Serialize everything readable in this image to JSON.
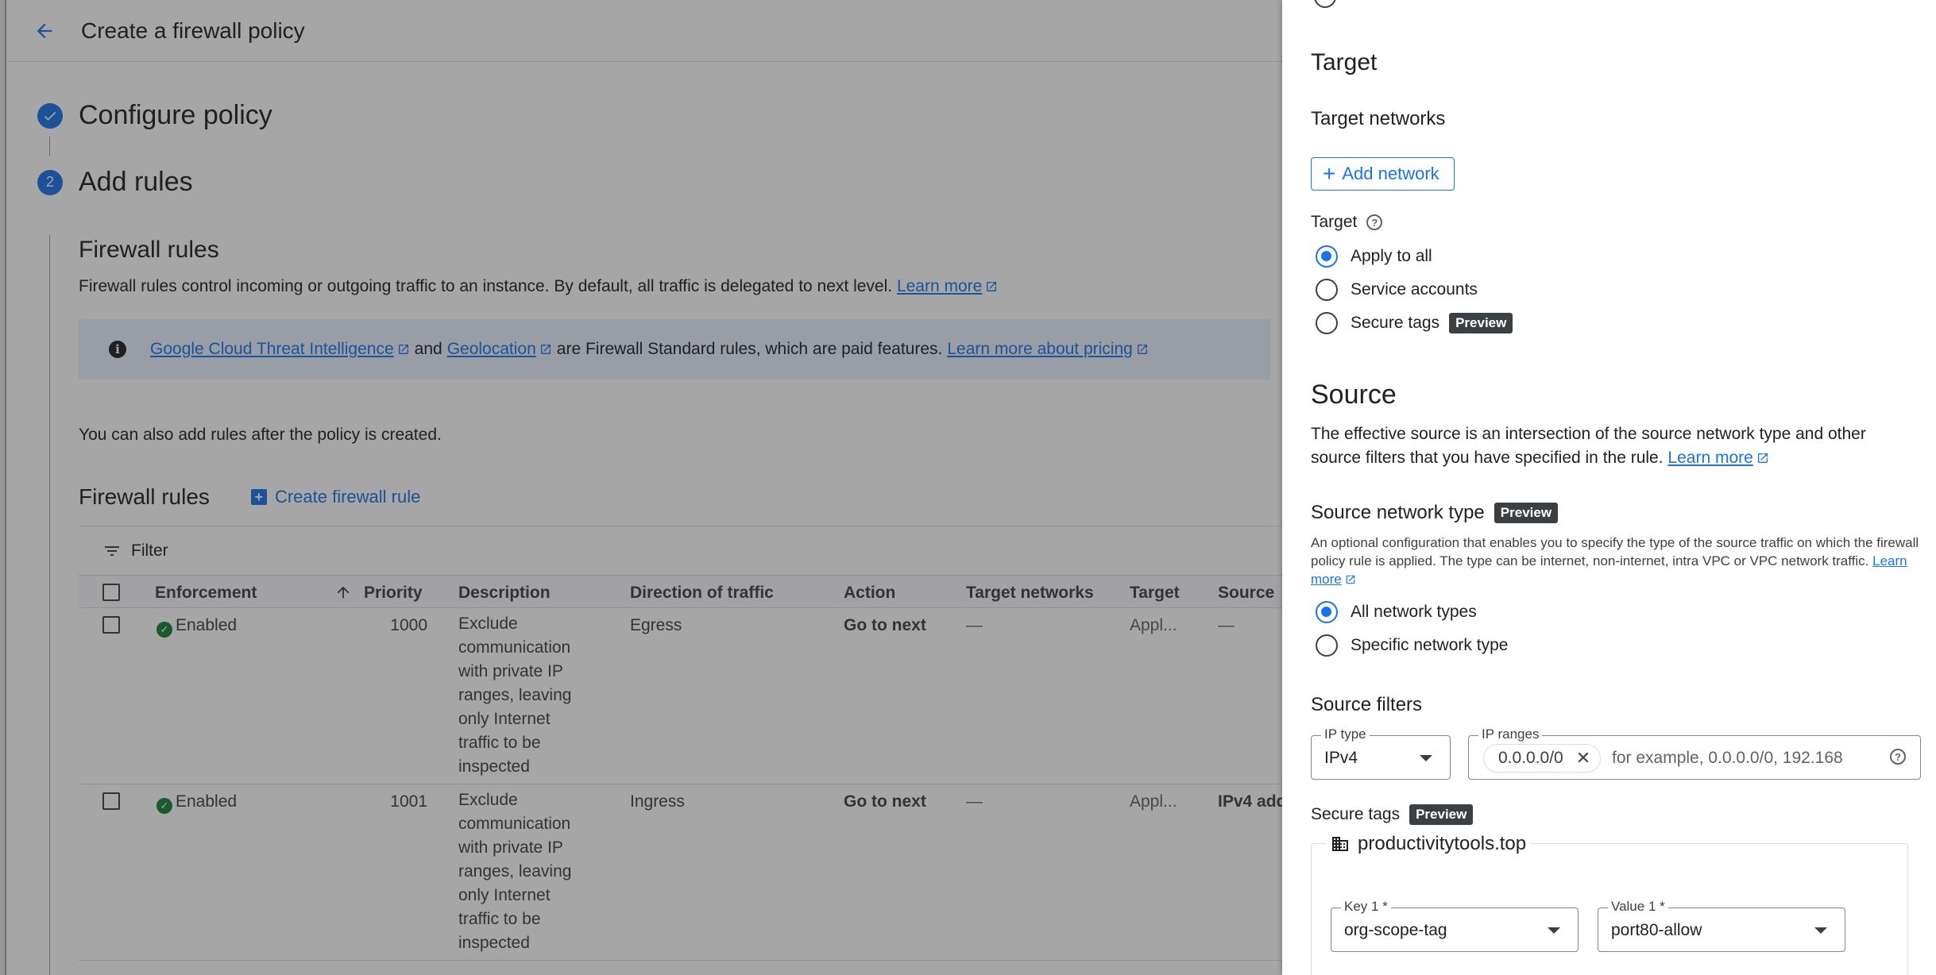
{
  "header": {
    "title": "Create a firewall policy"
  },
  "steps": [
    {
      "number": "",
      "label": "Configure policy"
    },
    {
      "number": "2",
      "label": "Add rules"
    }
  ],
  "firewall_section": {
    "title": "Firewall rules",
    "description": "Firewall rules control incoming or outgoing traffic to an instance. By default, all traffic is delegated to next level.",
    "learn_more": "Learn more"
  },
  "info_banner": {
    "link1": "Google Cloud Threat Intelligence",
    "and": "and",
    "link2": "Geolocation",
    "text": "are Firewall Standard rules, which are paid features.",
    "link3": "Learn more about pricing"
  },
  "after_note": "You can also add rules after the policy is created.",
  "rules_table": {
    "title": "Firewall rules",
    "create_label": "Create firewall rule",
    "filter_label": "Filter",
    "columns": [
      "Enforcement",
      "Priority",
      "Description",
      "Direction of traffic",
      "Action",
      "Target networks",
      "Target",
      "Source"
    ],
    "rows": [
      {
        "enforcement": "Enabled",
        "priority": "1000",
        "description": "Exclude communication with private IP ranges, leaving only Internet traffic to be inspected",
        "direction": "Egress",
        "action": "Go to next",
        "target_networks": "—",
        "target": "Appl...",
        "source": "—"
      },
      {
        "enforcement": "Enabled",
        "priority": "1001",
        "description": "Exclude communication with private IP ranges, leaving only Internet traffic to be inspected",
        "direction": "Ingress",
        "action": "Go to next",
        "target_networks": "—",
        "target": "Appl...",
        "source": "IPv4 add"
      }
    ]
  },
  "panel": {
    "target_title": "Target",
    "target_networks_label": "Target networks",
    "add_network_label": "Add network",
    "target_label": "Target",
    "target_options": [
      "Apply to all",
      "Service accounts",
      "Secure tags"
    ],
    "preview_badge": "Preview",
    "source_title": "Source",
    "source_desc": "The effective source is an intersection of the source network type and other source filters that you have specified in the rule.",
    "source_learn_more": "Learn more",
    "snt_title": "Source network type",
    "snt_desc": "An optional configuration that enables you to specify the type of the source traffic on which the firewall policy rule is applied. The type can be internet, non-internet, intra VPC or VPC network traffic.",
    "snt_learn_more": "Learn more",
    "snt_options": [
      "All network types",
      "Specific network type"
    ],
    "source_filters_title": "Source filters",
    "ip_type_label": "IP type",
    "ip_type_value": "IPv4",
    "ip_ranges_label": "IP ranges",
    "ip_chip": "0.0.0.0/0",
    "ip_placeholder": "for example, 0.0.0.0/0, 192.168",
    "secure_tags_label": "Secure tags",
    "org_name": "productivitytools.top",
    "key_label": "Key 1 *",
    "key_value": "org-scope-tag",
    "value_label": "Value 1 *",
    "value_value": "port80-allow"
  }
}
